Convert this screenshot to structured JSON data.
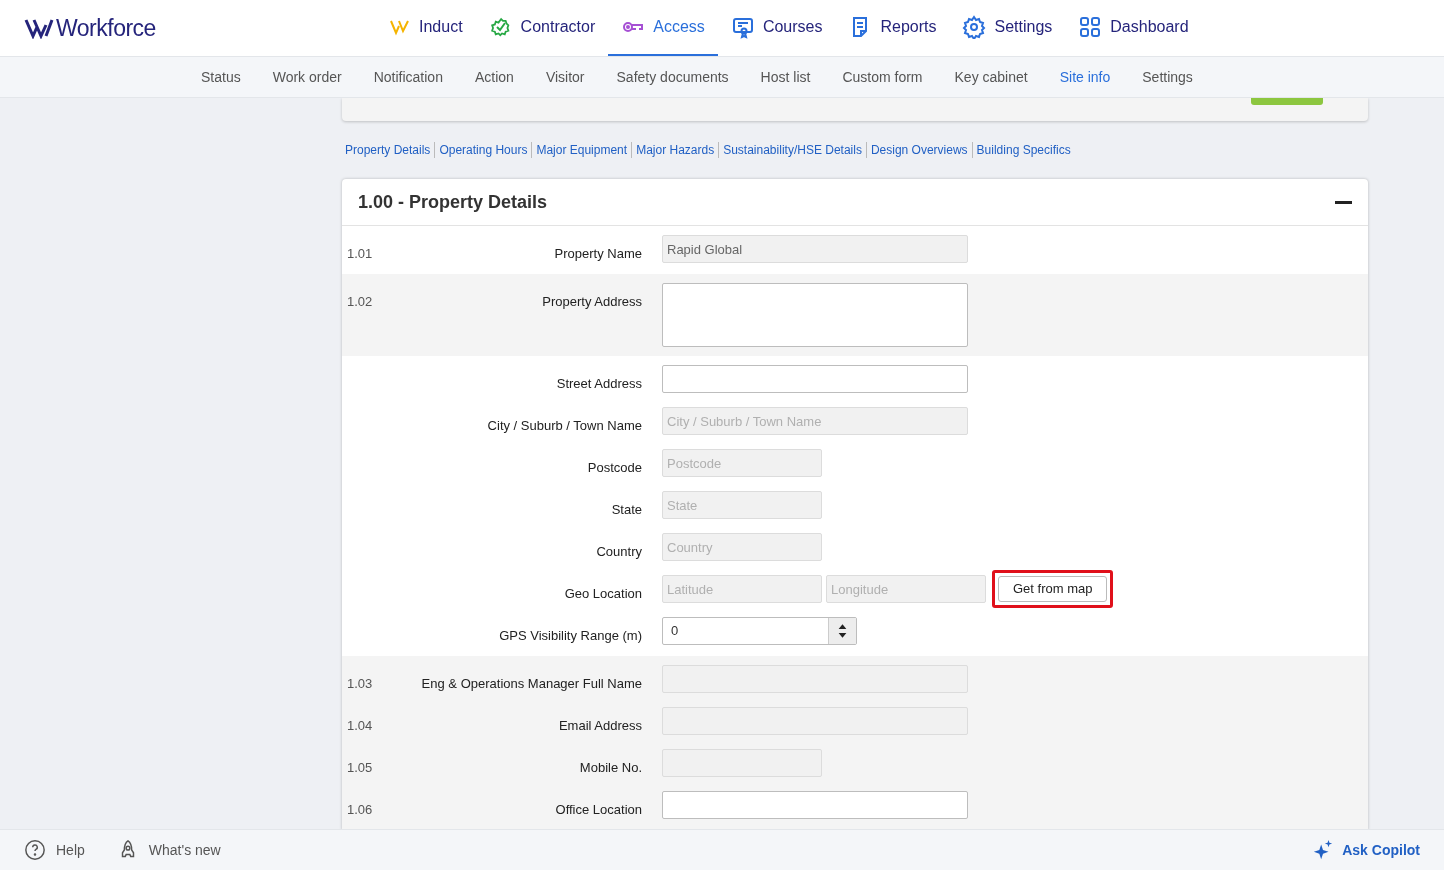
{
  "brand": "Workforce",
  "main_nav": [
    {
      "label": "Induct",
      "selected": false
    },
    {
      "label": "Contractor",
      "selected": false
    },
    {
      "label": "Access",
      "selected": true
    },
    {
      "label": "Courses",
      "selected": false
    },
    {
      "label": "Reports",
      "selected": false
    },
    {
      "label": "Settings",
      "selected": false
    },
    {
      "label": "Dashboard",
      "selected": false
    }
  ],
  "sub_nav": [
    {
      "label": "Status",
      "selected": false
    },
    {
      "label": "Work order",
      "selected": false
    },
    {
      "label": "Notification",
      "selected": false
    },
    {
      "label": "Action",
      "selected": false
    },
    {
      "label": "Visitor",
      "selected": false
    },
    {
      "label": "Safety documents",
      "selected": false
    },
    {
      "label": "Host list",
      "selected": false
    },
    {
      "label": "Custom form",
      "selected": false
    },
    {
      "label": "Key cabinet",
      "selected": false
    },
    {
      "label": "Site info",
      "selected": true
    },
    {
      "label": "Settings",
      "selected": false
    }
  ],
  "section_links": [
    "Property Details",
    "Operating Hours",
    "Major Equipment",
    "Major Hazards",
    "Sustainability/HSE Details",
    "Design Overviews",
    "Building Specifics"
  ],
  "panel": {
    "title": "1.00 - Property Details",
    "expanded": true,
    "groups": [
      {
        "rows": [
          {
            "number": "1.01",
            "label": "Property Name",
            "kind": "text",
            "disabled": true,
            "value": "Rapid Global"
          }
        ]
      },
      {
        "rows": [
          {
            "number": "1.02",
            "label": "Property Address",
            "kind": "textarea",
            "disabled": false
          }
        ]
      },
      {
        "rows": [
          {
            "label": "Street Address",
            "kind": "text",
            "disabled": false
          },
          {
            "label": "City / Suburb / Town Name",
            "kind": "text",
            "disabled": true,
            "placeholder": "City / Suburb / Town Name"
          },
          {
            "label": "Postcode",
            "kind": "short",
            "disabled": true,
            "placeholder": "Postcode"
          },
          {
            "label": "State",
            "kind": "short",
            "disabled": true,
            "placeholder": "State"
          },
          {
            "label": "Country",
            "kind": "short",
            "disabled": true,
            "placeholder": "Country"
          },
          {
            "label": "Geo Location",
            "kind": "geo",
            "disabled": true,
            "placeholder": "Latitude",
            "placeholder_2": "Longitude",
            "button": "Get from map",
            "highlighted": true
          },
          {
            "label": "GPS Visibility Range (m)",
            "kind": "number",
            "disabled": false,
            "value": "0"
          }
        ]
      },
      {
        "rows": [
          {
            "number": "1.03",
            "label": "Eng & Operations Manager Full Name",
            "kind": "text",
            "disabled": true
          },
          {
            "number": "1.04",
            "label": "Email Address",
            "kind": "text",
            "disabled": true
          },
          {
            "number": "1.05",
            "label": "Mobile No.",
            "kind": "short",
            "disabled": true
          },
          {
            "number": "1.06",
            "label": "Office Location",
            "kind": "text",
            "disabled": false
          }
        ]
      }
    ]
  },
  "footer": {
    "help": "Help",
    "whats_new": "What's new",
    "copilot": "Ask Copilot"
  }
}
